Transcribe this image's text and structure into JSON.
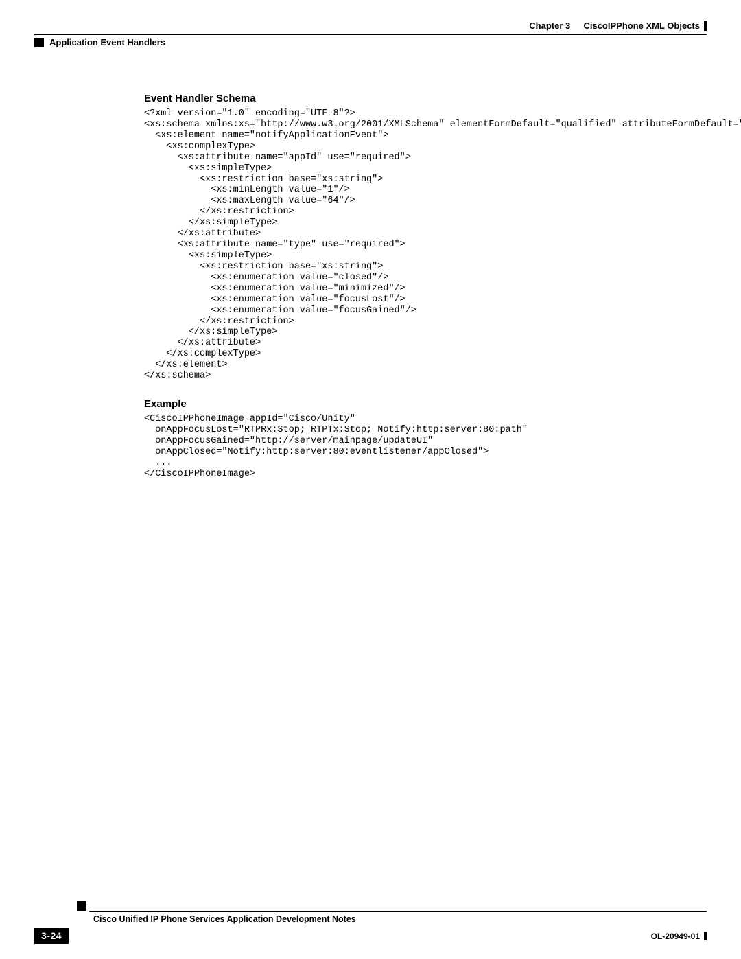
{
  "header": {
    "chapter_label": "Chapter 3",
    "chapter_title": "CiscoIPPhone XML Objects",
    "section": "Application Event Handlers"
  },
  "sections": {
    "schema": {
      "title": "Event Handler Schema",
      "code": "<?xml version=\"1.0\" encoding=\"UTF-8\"?>\n<xs:schema xmlns:xs=\"http://www.w3.org/2001/XMLSchema\" elementFormDefault=\"qualified\" attributeFormDefault=\"unqualified\">\n  <xs:element name=\"notifyApplicationEvent\">\n    <xs:complexType>\n      <xs:attribute name=\"appId\" use=\"required\">\n        <xs:simpleType>\n          <xs:restriction base=\"xs:string\">\n            <xs:minLength value=\"1\"/>\n            <xs:maxLength value=\"64\"/>\n          </xs:restriction>\n        </xs:simpleType>\n      </xs:attribute>\n      <xs:attribute name=\"type\" use=\"required\">\n        <xs:simpleType>\n          <xs:restriction base=\"xs:string\">\n            <xs:enumeration value=\"closed\"/>\n            <xs:enumeration value=\"minimized\"/>\n            <xs:enumeration value=\"focusLost\"/>\n            <xs:enumeration value=\"focusGained\"/>\n          </xs:restriction>\n        </xs:simpleType>\n      </xs:attribute>\n    </xs:complexType>\n  </xs:element>\n</xs:schema>"
    },
    "example": {
      "title": "Example",
      "code": "<CiscoIPPhoneImage appId=\"Cisco/Unity\"\n  onAppFocusLost=\"RTPRx:Stop; RTPTx:Stop; Notify:http:server:80:path\"\n  onAppFocusGained=\"http://server/mainpage/updateUI\"\n  onAppClosed=\"Notify:http:server:80:eventlistener/appClosed\">\n  ...\n</CiscoIPPhoneImage>"
    }
  },
  "footer": {
    "doc_title": "Cisco Unified IP Phone Services Application Development Notes",
    "page_num": "3-24",
    "doc_id": "OL-20949-01"
  }
}
